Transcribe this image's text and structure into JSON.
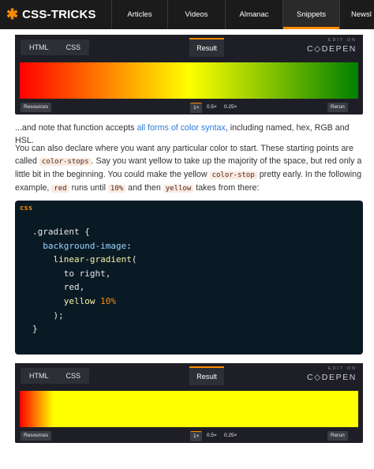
{
  "nav": {
    "logo_star": "✱",
    "logo_text": "CSS-TRICKS",
    "items": [
      {
        "label": "Articles"
      },
      {
        "label": "Videos"
      },
      {
        "label": "Almanac"
      },
      {
        "label": "Snippets"
      },
      {
        "label": "Newsl"
      }
    ]
  },
  "pen1": {
    "tab_html": "HTML",
    "tab_css": "CSS",
    "tab_result": "Result",
    "edit_on": "EDIT ON",
    "codepen": "C◇DEPEN",
    "resources": "Resources",
    "zoom": [
      "1×",
      "0.5×",
      "0.25×"
    ],
    "rerun": "Rerun",
    "gradient_colors": [
      "#ff0000",
      "#ffff00",
      "#008000"
    ]
  },
  "prose": {
    "p1_pre": "...and note that function accepts ",
    "p1_link": "all forms of color syntax",
    "p1_post": ", including named, hex, RGB and HSL.",
    "p2_a": "You can also declare where you want any particular color to start. These starting points are called ",
    "p2_code1": "color-stops",
    "p2_b": ". Say you want yellow to take up the majority of the space, but red only a little bit in the beginning. You could make the yellow ",
    "p2_code2": "color-stop",
    "p2_c": " pretty early. In the following example, ",
    "p2_code3": "red",
    "p2_d": " runs until ",
    "p2_code4": "10%",
    "p2_e": " and then ",
    "p2_code5": "yellow",
    "p2_f": " takes from there:"
  },
  "code": {
    "lang": "css",
    "l1": ".gradient {",
    "l2_prop": "background-image",
    "l2_colon": ":",
    "l3_fn": "linear-gradient",
    "l3_paren": "(",
    "l4": "to right,",
    "l5": "red,",
    "l6_kw": "yellow",
    "l6_num": "10%",
    "l7": ");",
    "l8": "}"
  },
  "pen2": {
    "tab_html": "HTML",
    "tab_css": "CSS",
    "tab_result": "Result",
    "edit_on": "EDIT ON",
    "codepen": "C◇DEPEN",
    "resources": "Resources",
    "zoom": [
      "1×",
      "0.5×",
      "0.25×"
    ],
    "rerun": "Rerun",
    "gradient_colors": [
      "#ff0000",
      "#ffff00"
    ],
    "yellow_stop": "10%"
  },
  "colors": {
    "accent": "#ff8a00",
    "link": "#2f7bd6",
    "nav_bg": "#1b1b1b",
    "code_bg": "#0a1a25"
  }
}
